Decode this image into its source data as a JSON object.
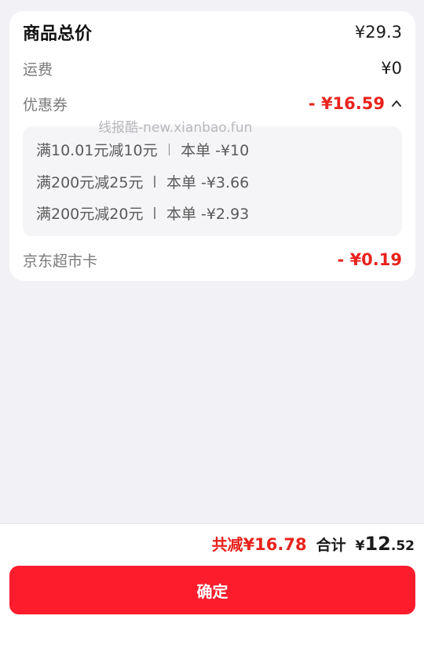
{
  "price_card": {
    "total_label": "商品总价",
    "total_value": "¥29.3",
    "shipping_label": "运费",
    "shipping_value": "¥0",
    "coupon_label": "优惠券",
    "coupon_value": "- ¥16.59",
    "coupon_expanded": true,
    "watermark": "线报酷-new.xianbao.fun",
    "coupons": [
      {
        "rule": "满10.01元减10元",
        "discount": "本单 -¥10"
      },
      {
        "rule": "满200元减25元",
        "discount": "本单 -¥3.66"
      },
      {
        "rule": "满200元减20元",
        "discount": "本单 -¥2.93"
      }
    ],
    "supermarket_card_label": "京东超市卡",
    "supermarket_card_value": "- ¥0.19"
  },
  "bottom_bar": {
    "saved_prefix": "共减",
    "saved_value": "¥16.78",
    "total_label": "合计",
    "total_currency": "¥",
    "total_integer": "12",
    "total_decimal": ".52",
    "confirm_label": "确定"
  },
  "colors": {
    "accent_red": "#e8231d",
    "button_red": "#fc1c2c",
    "background": "#f2f2f6"
  },
  "icons": {
    "coupon_toggle": "chevron-up-icon"
  }
}
